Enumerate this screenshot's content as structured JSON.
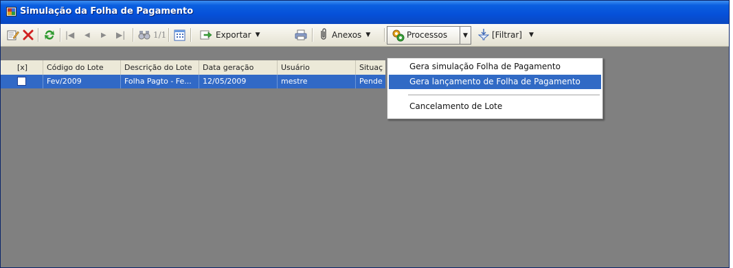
{
  "window": {
    "title": "Simulação da Folha de Pagamento"
  },
  "toolbar": {
    "page_indicator": "1/1",
    "exportar_label": "Exportar",
    "anexos_label": "Anexos",
    "processos_label": "Processos",
    "filtrar_label": "[Filtrar]"
  },
  "grid": {
    "columns": [
      "[x]",
      "Código do Lote",
      "Descrição do Lote",
      "Data geração",
      "Usuário",
      "Situaç"
    ],
    "rows": [
      {
        "checked": false,
        "codigo": "Fev/2009",
        "descricao": "Folha Pagto - Fe...",
        "data": "12/05/2009",
        "usuario": "mestre",
        "situacao": "Pende"
      }
    ]
  },
  "menu": {
    "items": [
      {
        "label": "Gera simulação Folha de Pagamento",
        "selected": false
      },
      {
        "label": "Gera lançamento de Folha de Pagamento",
        "selected": true
      },
      {
        "label": "Cancelamento de Lote",
        "selected": false
      }
    ]
  },
  "colors": {
    "titlebar": "#0a5fe0",
    "selection": "#316ac5",
    "background": "#808080"
  }
}
